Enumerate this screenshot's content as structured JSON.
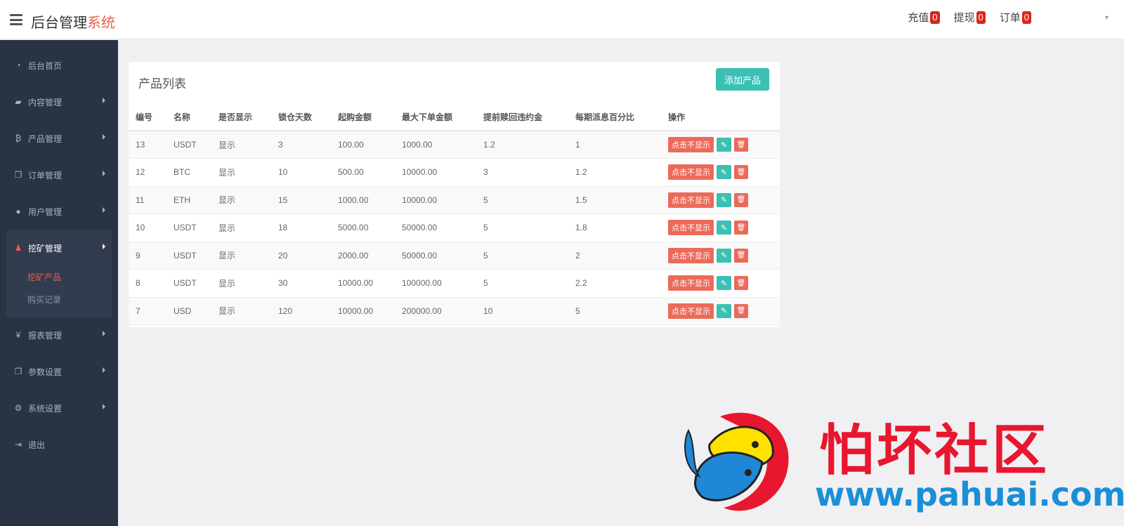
{
  "header": {
    "brand_main": "后台管理",
    "brand_accent": "系统",
    "stats": [
      {
        "label": "充值",
        "count": "0"
      },
      {
        "label": "提现",
        "count": "0"
      },
      {
        "label": "订单",
        "count": "0"
      }
    ]
  },
  "sidebar": {
    "items": [
      {
        "label": "后台首页",
        "icon": "dashboard-icon"
      },
      {
        "label": "内容管理",
        "icon": "book-icon"
      },
      {
        "label": "产品管理",
        "icon": "bitcoin-icon"
      },
      {
        "label": "订单管理",
        "icon": "copy-icon"
      },
      {
        "label": "用户管理",
        "icon": "user-icon"
      },
      {
        "label": "挖矿管理",
        "icon": "user-red-icon"
      },
      {
        "label": "报表管理",
        "icon": "yen-icon"
      },
      {
        "label": "参数设置",
        "icon": "copy-icon"
      },
      {
        "label": "系统设置",
        "icon": "gears-icon"
      },
      {
        "label": "退出",
        "icon": "sign-out-icon"
      }
    ],
    "sub_items": [
      {
        "label": "挖矿产品"
      },
      {
        "label": "购买记录"
      }
    ]
  },
  "panel": {
    "title": "产品列表",
    "add_label": "添加产品"
  },
  "table": {
    "columns": [
      "编号",
      "名称",
      "是否显示",
      "锁仓天数",
      "起购金额",
      "最大下单金额",
      "提前赎回违约金",
      "每期派息百分比",
      "操作"
    ],
    "hide_label": "点击不显示",
    "rows": [
      [
        "13",
        "USDT",
        "显示",
        "3",
        "100.00",
        "1000.00",
        "1.2",
        "1"
      ],
      [
        "12",
        "BTC",
        "显示",
        "10",
        "500.00",
        "10000.00",
        "3",
        "1.2"
      ],
      [
        "11",
        "ETH",
        "显示",
        "15",
        "1000.00",
        "10000.00",
        "5",
        "1.5"
      ],
      [
        "10",
        "USDT",
        "显示",
        "18",
        "5000.00",
        "50000.00",
        "5",
        "1.8"
      ],
      [
        "9",
        "USDT",
        "显示",
        "20",
        "2000.00",
        "50000.00",
        "5",
        "2"
      ],
      [
        "8",
        "USDT",
        "显示",
        "30",
        "10000.00",
        "100000.00",
        "5",
        "2.2"
      ],
      [
        "7",
        "USD",
        "显示",
        "120",
        "10000.00",
        "200000.00",
        "10",
        "5"
      ]
    ]
  },
  "watermark": {
    "name": "怕坏社区",
    "url": "www.pahuai.com"
  },
  "colors": {
    "accent": "#e8604c",
    "teal": "#3cc0b4",
    "danger": "#ec6a5a",
    "sidebar": "#2a3344"
  }
}
